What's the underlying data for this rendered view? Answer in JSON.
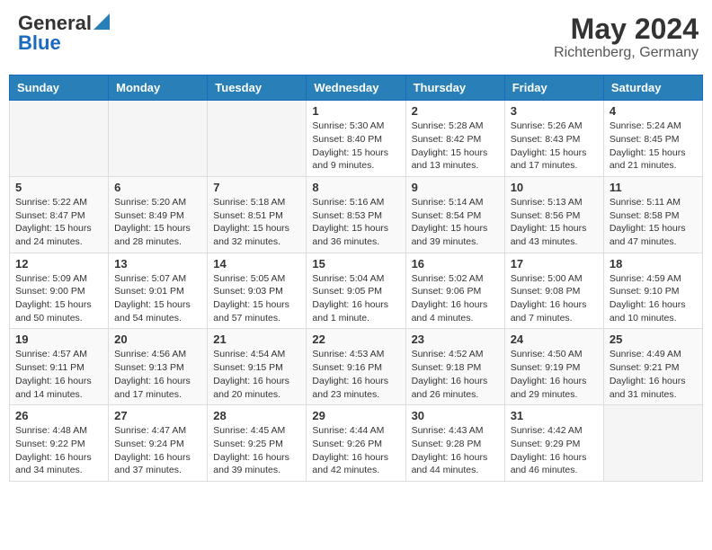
{
  "header": {
    "logo_general": "General",
    "logo_blue": "Blue",
    "month_year": "May 2024",
    "location": "Richtenberg, Germany"
  },
  "days_of_week": [
    "Sunday",
    "Monday",
    "Tuesday",
    "Wednesday",
    "Thursday",
    "Friday",
    "Saturday"
  ],
  "weeks": [
    [
      {
        "day": "",
        "info": ""
      },
      {
        "day": "",
        "info": ""
      },
      {
        "day": "",
        "info": ""
      },
      {
        "day": "1",
        "info": "Sunrise: 5:30 AM\nSunset: 8:40 PM\nDaylight: 15 hours\nand 9 minutes."
      },
      {
        "day": "2",
        "info": "Sunrise: 5:28 AM\nSunset: 8:42 PM\nDaylight: 15 hours\nand 13 minutes."
      },
      {
        "day": "3",
        "info": "Sunrise: 5:26 AM\nSunset: 8:43 PM\nDaylight: 15 hours\nand 17 minutes."
      },
      {
        "day": "4",
        "info": "Sunrise: 5:24 AM\nSunset: 8:45 PM\nDaylight: 15 hours\nand 21 minutes."
      }
    ],
    [
      {
        "day": "5",
        "info": "Sunrise: 5:22 AM\nSunset: 8:47 PM\nDaylight: 15 hours\nand 24 minutes."
      },
      {
        "day": "6",
        "info": "Sunrise: 5:20 AM\nSunset: 8:49 PM\nDaylight: 15 hours\nand 28 minutes."
      },
      {
        "day": "7",
        "info": "Sunrise: 5:18 AM\nSunset: 8:51 PM\nDaylight: 15 hours\nand 32 minutes."
      },
      {
        "day": "8",
        "info": "Sunrise: 5:16 AM\nSunset: 8:53 PM\nDaylight: 15 hours\nand 36 minutes."
      },
      {
        "day": "9",
        "info": "Sunrise: 5:14 AM\nSunset: 8:54 PM\nDaylight: 15 hours\nand 39 minutes."
      },
      {
        "day": "10",
        "info": "Sunrise: 5:13 AM\nSunset: 8:56 PM\nDaylight: 15 hours\nand 43 minutes."
      },
      {
        "day": "11",
        "info": "Sunrise: 5:11 AM\nSunset: 8:58 PM\nDaylight: 15 hours\nand 47 minutes."
      }
    ],
    [
      {
        "day": "12",
        "info": "Sunrise: 5:09 AM\nSunset: 9:00 PM\nDaylight: 15 hours\nand 50 minutes."
      },
      {
        "day": "13",
        "info": "Sunrise: 5:07 AM\nSunset: 9:01 PM\nDaylight: 15 hours\nand 54 minutes."
      },
      {
        "day": "14",
        "info": "Sunrise: 5:05 AM\nSunset: 9:03 PM\nDaylight: 15 hours\nand 57 minutes."
      },
      {
        "day": "15",
        "info": "Sunrise: 5:04 AM\nSunset: 9:05 PM\nDaylight: 16 hours\nand 1 minute."
      },
      {
        "day": "16",
        "info": "Sunrise: 5:02 AM\nSunset: 9:06 PM\nDaylight: 16 hours\nand 4 minutes."
      },
      {
        "day": "17",
        "info": "Sunrise: 5:00 AM\nSunset: 9:08 PM\nDaylight: 16 hours\nand 7 minutes."
      },
      {
        "day": "18",
        "info": "Sunrise: 4:59 AM\nSunset: 9:10 PM\nDaylight: 16 hours\nand 10 minutes."
      }
    ],
    [
      {
        "day": "19",
        "info": "Sunrise: 4:57 AM\nSunset: 9:11 PM\nDaylight: 16 hours\nand 14 minutes."
      },
      {
        "day": "20",
        "info": "Sunrise: 4:56 AM\nSunset: 9:13 PM\nDaylight: 16 hours\nand 17 minutes."
      },
      {
        "day": "21",
        "info": "Sunrise: 4:54 AM\nSunset: 9:15 PM\nDaylight: 16 hours\nand 20 minutes."
      },
      {
        "day": "22",
        "info": "Sunrise: 4:53 AM\nSunset: 9:16 PM\nDaylight: 16 hours\nand 23 minutes."
      },
      {
        "day": "23",
        "info": "Sunrise: 4:52 AM\nSunset: 9:18 PM\nDaylight: 16 hours\nand 26 minutes."
      },
      {
        "day": "24",
        "info": "Sunrise: 4:50 AM\nSunset: 9:19 PM\nDaylight: 16 hours\nand 29 minutes."
      },
      {
        "day": "25",
        "info": "Sunrise: 4:49 AM\nSunset: 9:21 PM\nDaylight: 16 hours\nand 31 minutes."
      }
    ],
    [
      {
        "day": "26",
        "info": "Sunrise: 4:48 AM\nSunset: 9:22 PM\nDaylight: 16 hours\nand 34 minutes."
      },
      {
        "day": "27",
        "info": "Sunrise: 4:47 AM\nSunset: 9:24 PM\nDaylight: 16 hours\nand 37 minutes."
      },
      {
        "day": "28",
        "info": "Sunrise: 4:45 AM\nSunset: 9:25 PM\nDaylight: 16 hours\nand 39 minutes."
      },
      {
        "day": "29",
        "info": "Sunrise: 4:44 AM\nSunset: 9:26 PM\nDaylight: 16 hours\nand 42 minutes."
      },
      {
        "day": "30",
        "info": "Sunrise: 4:43 AM\nSunset: 9:28 PM\nDaylight: 16 hours\nand 44 minutes."
      },
      {
        "day": "31",
        "info": "Sunrise: 4:42 AM\nSunset: 9:29 PM\nDaylight: 16 hours\nand 46 minutes."
      },
      {
        "day": "",
        "info": ""
      }
    ]
  ]
}
